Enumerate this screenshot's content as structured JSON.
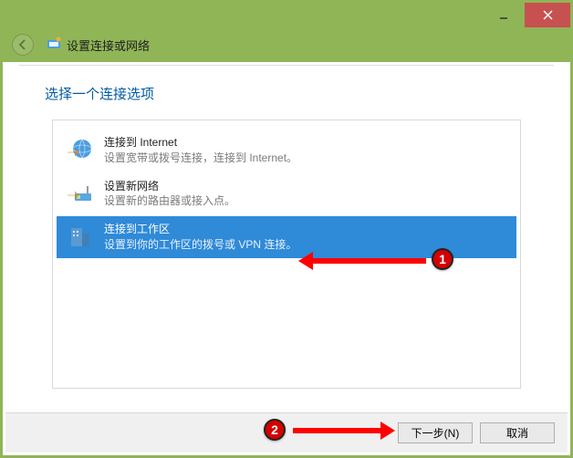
{
  "window": {
    "title": "设置连接或网络"
  },
  "heading": "选择一个连接选项",
  "options": [
    {
      "title": "连接到 Internet",
      "desc": "设置宽带或拨号连接，连接到 Internet。"
    },
    {
      "title": "设置新网络",
      "desc": "设置新的路由器或接入点。"
    },
    {
      "title": "连接到工作区",
      "desc": "设置到你的工作区的拨号或 VPN 连接。"
    }
  ],
  "buttons": {
    "next": "下一步(N)",
    "cancel": "取消"
  },
  "annotations": {
    "badge1": "1",
    "badge2": "2"
  }
}
